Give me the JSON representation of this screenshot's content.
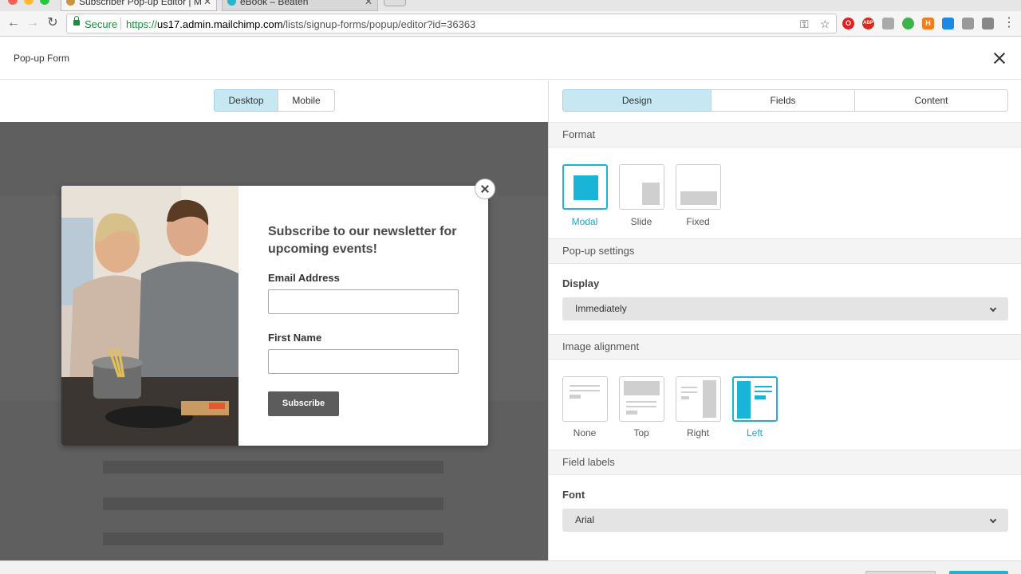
{
  "browser": {
    "tabs": [
      {
        "label": "Subscriber Pop-up Editor | M"
      },
      {
        "label": "eBook – Beaten"
      }
    ],
    "secure_label": "Secure",
    "url_protocol": "https://",
    "url_host": "us17.admin.mailchimp.com",
    "url_path": "/lists/signup-forms/popup/editor?id=36363"
  },
  "app": {
    "title": "Pop-up Form"
  },
  "preview": {
    "device_tabs": [
      {
        "label": "Desktop",
        "active": true
      },
      {
        "label": "Mobile",
        "active": false
      }
    ],
    "popup": {
      "heading": "Subscribe to our newsletter for upcoming events!",
      "email_label": "Email Address",
      "first_name_label": "First Name",
      "subscribe_label": "Subscribe"
    }
  },
  "panel": {
    "tabs": [
      {
        "label": "Design",
        "active": true
      },
      {
        "label": "Fields",
        "active": false
      },
      {
        "label": "Content",
        "active": false
      }
    ],
    "format": {
      "heading": "Format",
      "options": [
        {
          "label": "Modal",
          "selected": true
        },
        {
          "label": "Slide",
          "selected": false
        },
        {
          "label": "Fixed",
          "selected": false
        }
      ]
    },
    "popup_settings": {
      "heading": "Pop-up settings",
      "display_label": "Display",
      "display_value": "Immediately"
    },
    "image_alignment": {
      "heading": "Image alignment",
      "options": [
        {
          "label": "None",
          "selected": false
        },
        {
          "label": "Top",
          "selected": false
        },
        {
          "label": "Right",
          "selected": false
        },
        {
          "label": "Left",
          "selected": true
        }
      ]
    },
    "field_labels": {
      "heading": "Field labels",
      "font_label": "Font",
      "font_value": "Arial"
    }
  },
  "colors": {
    "accent": "#19b4d6",
    "tab_active": "#c7e8f3",
    "overlay": "#5f5f5f",
    "secure_green": "#1a8f3c",
    "button_dark": "#5c5c5c"
  }
}
